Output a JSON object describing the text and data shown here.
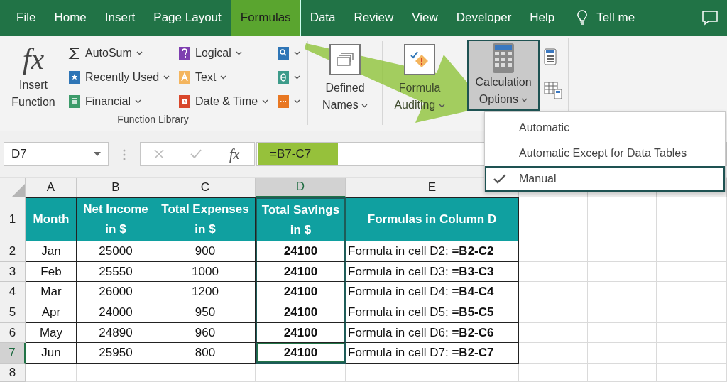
{
  "tabs": [
    {
      "label": "File",
      "selected": false
    },
    {
      "label": "Home",
      "selected": false
    },
    {
      "label": "Insert",
      "selected": false
    },
    {
      "label": "Page Layout",
      "selected": false
    },
    {
      "label": "Formulas",
      "selected": true
    },
    {
      "label": "Data",
      "selected": false
    },
    {
      "label": "Review",
      "selected": false
    },
    {
      "label": "View",
      "selected": false
    },
    {
      "label": "Developer",
      "selected": false
    },
    {
      "label": "Help",
      "selected": false
    }
  ],
  "tell_me": "Tell me",
  "ribbon": {
    "insert_function": {
      "icon": "fx",
      "label": "Insert Function"
    },
    "function_library": {
      "label": "Function Library",
      "commands": [
        {
          "kind": "autosum",
          "label": "AutoSum"
        },
        {
          "kind": "recent",
          "label": "Recently Used"
        },
        {
          "kind": "financial",
          "label": "Financial"
        },
        {
          "kind": "logical",
          "label": "Logical"
        },
        {
          "kind": "text",
          "label": "Text"
        },
        {
          "kind": "datetime",
          "label": "Date & Time"
        },
        {
          "kind": "lookup"
        },
        {
          "kind": "math"
        },
        {
          "kind": "more"
        }
      ]
    },
    "defined_names": {
      "label": "Defined Names"
    },
    "formula_auditing": {
      "label": "Formula Auditing"
    },
    "calculation_options": {
      "label": "Calculation Options",
      "pressed": true
    }
  },
  "calculation_menu": [
    {
      "label": "Automatic",
      "selected": false
    },
    {
      "label": "Automatic Except for Data Tables",
      "selected": false
    },
    {
      "label": "Manual",
      "selected": true
    }
  ],
  "formula_bar": {
    "name_box": "D7",
    "function_button": "fx",
    "formula": "=B7-C7"
  },
  "sheet": {
    "columns": [
      {
        "label": "A",
        "selected": false
      },
      {
        "label": "B",
        "selected": false
      },
      {
        "label": "C",
        "selected": false
      },
      {
        "label": "D",
        "selected": true
      },
      {
        "label": "E",
        "selected": false
      }
    ],
    "row_numbers": [
      {
        "label": "1",
        "selected": false
      },
      {
        "label": "2",
        "selected": false
      },
      {
        "label": "3",
        "selected": false
      },
      {
        "label": "4",
        "selected": false
      },
      {
        "label": "5",
        "selected": false
      },
      {
        "label": "6",
        "selected": false
      },
      {
        "label": "7",
        "selected": true
      },
      {
        "label": "8",
        "selected": false
      }
    ],
    "header": [
      "Month",
      "Net Income\nin $",
      "Total Expenses\nin $",
      "Total Savings\nin $",
      "Formulas in Column D"
    ],
    "rows": [
      {
        "active": false,
        "cells": [
          "Jan",
          "25000",
          "900",
          "24100",
          "Formula in cell D2: **=B2-C2**"
        ]
      },
      {
        "active": false,
        "cells": [
          "Feb",
          "25550",
          "1000",
          "24100",
          "Formula in cell D3: **=B3-C3**"
        ]
      },
      {
        "active": false,
        "cells": [
          "Mar",
          "26000",
          "1200",
          "24100",
          "Formula in cell D4: **=B4-C4**"
        ]
      },
      {
        "active": false,
        "cells": [
          "Apr",
          "24000",
          "950",
          "24100",
          "Formula in cell D5: **=B5-C5**"
        ]
      },
      {
        "active": false,
        "cells": [
          "May",
          "24890",
          "960",
          "24100",
          "Formula in cell D6: **=B2-C6**"
        ]
      },
      {
        "active": true,
        "cells": [
          "Jun",
          "25950",
          "800",
          "24100",
          "Formula in cell D7: **=B2-C7**"
        ]
      }
    ]
  }
}
